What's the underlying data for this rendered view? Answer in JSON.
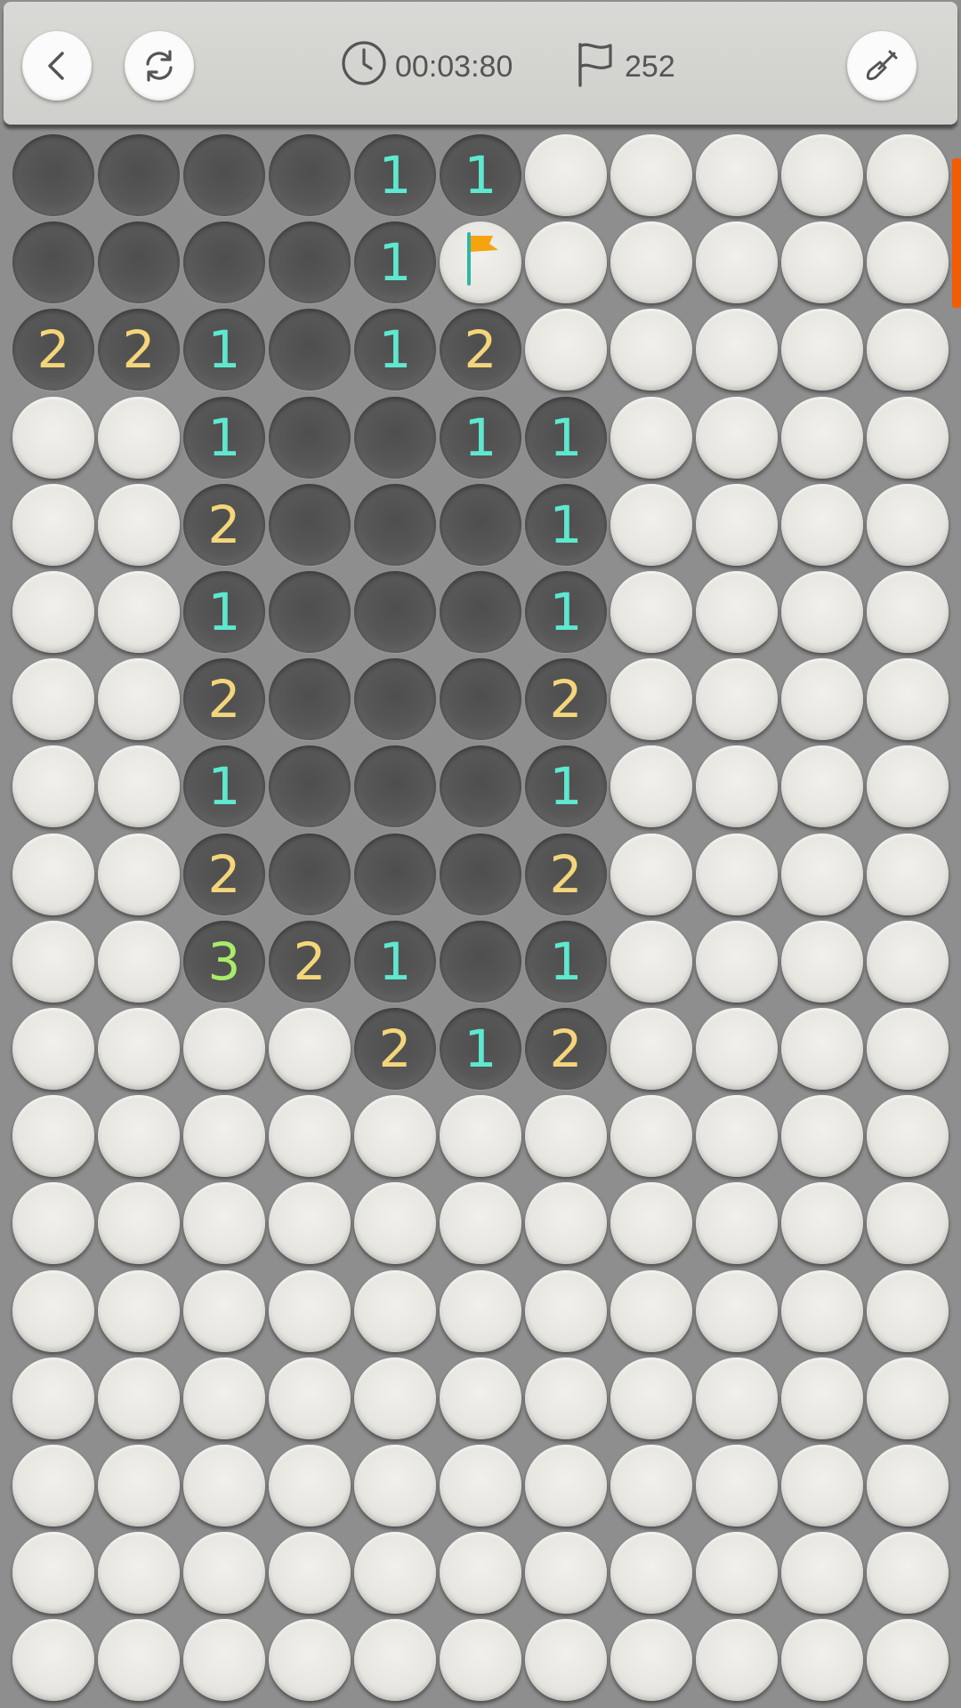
{
  "header": {
    "back_icon": "chevron-left-icon",
    "restart_icon": "refresh-icon",
    "timer_icon": "clock-icon",
    "timer": "00:03:80",
    "flag_icon": "flag-outline-icon",
    "flags_remaining": "252",
    "mode_icon": "shovel-icon"
  },
  "colors": {
    "one": "#5ee8cf",
    "two": "#f4d57a",
    "three": "#a8ec6a",
    "flag": "#f5a30f",
    "flag_pole": "#2fb5a4",
    "scroll_indicator": "#f25c05"
  },
  "board": {
    "columns": 11,
    "visible_rows": 18,
    "legend": "H = hidden, R = revealed empty, F = flagged, digits = revealed count",
    "rows": [
      [
        "R",
        "R",
        "R",
        "R",
        "1",
        "1",
        "H",
        "H",
        "H",
        "H",
        "H"
      ],
      [
        "R",
        "R",
        "R",
        "R",
        "1",
        "F",
        "H",
        "H",
        "H",
        "H",
        "H"
      ],
      [
        "2",
        "2",
        "1",
        "R",
        "1",
        "2",
        "H",
        "H",
        "H",
        "H",
        "H"
      ],
      [
        "H",
        "H",
        "1",
        "R",
        "R",
        "1",
        "1",
        "H",
        "H",
        "H",
        "H"
      ],
      [
        "H",
        "H",
        "2",
        "R",
        "R",
        "R",
        "1",
        "H",
        "H",
        "H",
        "H"
      ],
      [
        "H",
        "H",
        "1",
        "R",
        "R",
        "R",
        "1",
        "H",
        "H",
        "H",
        "H"
      ],
      [
        "H",
        "H",
        "2",
        "R",
        "R",
        "R",
        "2",
        "H",
        "H",
        "H",
        "H"
      ],
      [
        "H",
        "H",
        "1",
        "R",
        "R",
        "R",
        "1",
        "H",
        "H",
        "H",
        "H"
      ],
      [
        "H",
        "H",
        "2",
        "R",
        "R",
        "R",
        "2",
        "H",
        "H",
        "H",
        "H"
      ],
      [
        "H",
        "H",
        "3",
        "2",
        "1",
        "R",
        "1",
        "H",
        "H",
        "H",
        "H"
      ],
      [
        "H",
        "H",
        "H",
        "H",
        "2",
        "1",
        "2",
        "H",
        "H",
        "H",
        "H"
      ],
      [
        "H",
        "H",
        "H",
        "H",
        "H",
        "H",
        "H",
        "H",
        "H",
        "H",
        "H"
      ],
      [
        "H",
        "H",
        "H",
        "H",
        "H",
        "H",
        "H",
        "H",
        "H",
        "H",
        "H"
      ],
      [
        "H",
        "H",
        "H",
        "H",
        "H",
        "H",
        "H",
        "H",
        "H",
        "H",
        "H"
      ],
      [
        "H",
        "H",
        "H",
        "H",
        "H",
        "H",
        "H",
        "H",
        "H",
        "H",
        "H"
      ],
      [
        "H",
        "H",
        "H",
        "H",
        "H",
        "H",
        "H",
        "H",
        "H",
        "H",
        "H"
      ],
      [
        "H",
        "H",
        "H",
        "H",
        "H",
        "H",
        "H",
        "H",
        "H",
        "H",
        "H"
      ],
      [
        "H",
        "H",
        "H",
        "H",
        "H",
        "H",
        "H",
        "H",
        "H",
        "H",
        "H"
      ]
    ]
  }
}
